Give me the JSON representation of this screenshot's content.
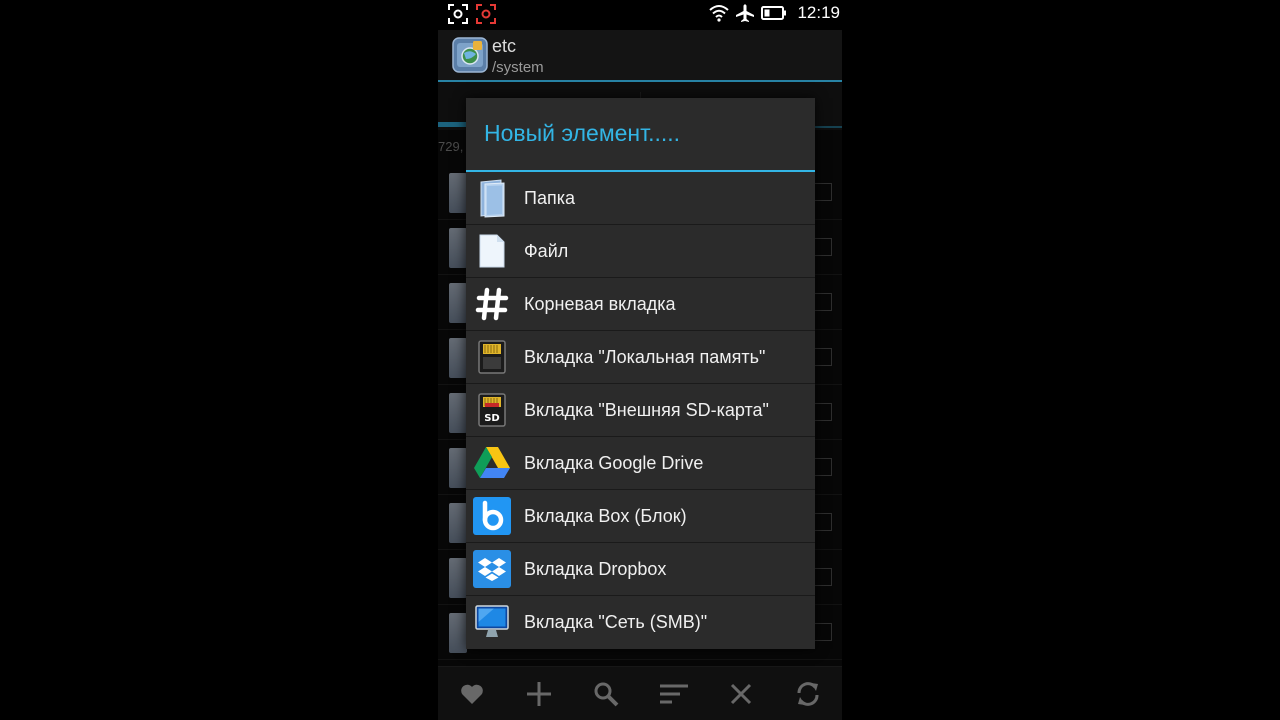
{
  "status_bar": {
    "time": "12:19"
  },
  "action_bar": {
    "title": "etc",
    "subtitle": "/system"
  },
  "background": {
    "info_text": "729,"
  },
  "dialog": {
    "title": "Новый элемент.....",
    "items": [
      {
        "label": "Папка",
        "icon": "folder-icon"
      },
      {
        "label": "Файл",
        "icon": "file-icon"
      },
      {
        "label": "Корневая вкладка",
        "icon": "hash-icon"
      },
      {
        "label": "Вкладка \"Локальная память\"",
        "icon": "sd-card-icon"
      },
      {
        "label": "Вкладка \"Внешняя SD-карта\"",
        "icon": "external-sd-icon"
      },
      {
        "label": "Вкладка Google Drive",
        "icon": "google-drive-icon"
      },
      {
        "label": "Вкладка Box (Блок)",
        "icon": "box-icon"
      },
      {
        "label": "Вкладка Dropbox",
        "icon": "dropbox-icon"
      },
      {
        "label": "Вкладка \"Сеть (SMB)\"",
        "icon": "network-monitor-icon"
      }
    ]
  },
  "toolbar": {
    "buttons": [
      "heart-icon",
      "plus-icon",
      "search-icon",
      "sort-icon",
      "close-icon",
      "refresh-icon"
    ]
  },
  "colors": {
    "accent": "#33b5e5",
    "dialog_bg": "#2b2b2b"
  }
}
